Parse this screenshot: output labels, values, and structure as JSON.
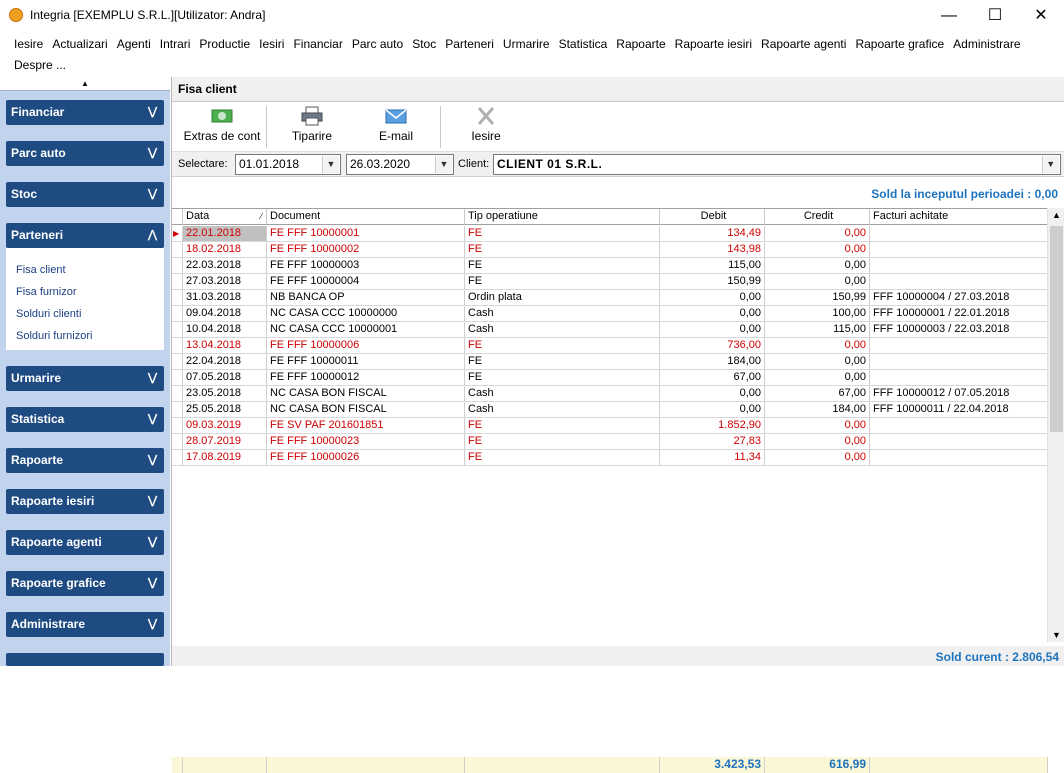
{
  "window": {
    "title": "Integria [EXEMPLU S.R.L.][Utilizator: Andra]"
  },
  "menu": {
    "items": [
      "Iesire",
      "Actualizari",
      "Agenti",
      "Intrari",
      "Productie",
      "Iesiri",
      "Financiar",
      "Parc auto",
      "Stoc",
      "Parteneri",
      "Urmarire",
      "Statistica",
      "Rapoarte",
      "Rapoarte iesiri",
      "Rapoarte agenti",
      "Rapoarte grafice",
      "Administrare",
      "Despre ..."
    ]
  },
  "sidebar": {
    "groups": [
      "Financiar",
      "Parc auto",
      "Stoc",
      "Parteneri",
      "Urmarire",
      "Statistica",
      "Rapoarte",
      "Rapoarte iesiri",
      "Rapoarte agenti",
      "Rapoarte grafice",
      "Administrare"
    ],
    "sub_items": [
      "Fisa client",
      "Fisa furnizor",
      "Solduri clienti",
      "Solduri furnizori"
    ]
  },
  "panel": {
    "title": "Fisa client"
  },
  "toolbar": {
    "extras": "Extras de cont",
    "print": "Tiparire",
    "email": "E-mail",
    "exit": "Iesire"
  },
  "filter": {
    "selectare_label": "Selectare:",
    "date_from": "01.01.2018",
    "date_to": "26.03.2020",
    "client_label": "Client:",
    "client": "CLIENT 01 S.R.L."
  },
  "sold_start": "Sold la inceputul perioadei : 0,00",
  "grid": {
    "columns": [
      "Data",
      "Document",
      "Tip operatiune",
      "Debit",
      "Credit",
      "Facturi achitate"
    ],
    "rows": [
      {
        "date": "22.01.2018",
        "doc": "FE FFF 10000001",
        "tip": "FE",
        "debit": "134,49",
        "credit": "0,00",
        "facturi": "",
        "red": true,
        "sel": true
      },
      {
        "date": "18.02.2018",
        "doc": "FE FFF 10000002",
        "tip": "FE",
        "debit": "143,98",
        "credit": "0,00",
        "facturi": "",
        "red": true
      },
      {
        "date": "22.03.2018",
        "doc": "FE FFF 10000003",
        "tip": "FE",
        "debit": "115,00",
        "credit": "0,00",
        "facturi": "",
        "red": false
      },
      {
        "date": "27.03.2018",
        "doc": "FE FFF 10000004",
        "tip": "FE",
        "debit": "150,99",
        "credit": "0,00",
        "facturi": "",
        "red": false
      },
      {
        "date": "31.03.2018",
        "doc": "NB BANCA OP",
        "tip": "Ordin plata",
        "debit": "0,00",
        "credit": "150,99",
        "facturi": "FFF 10000004 / 27.03.2018",
        "red": false
      },
      {
        "date": "09.04.2018",
        "doc": "NC CASA CCC 10000000",
        "tip": "Cash",
        "debit": "0,00",
        "credit": "100,00",
        "facturi": "FFF 10000001 / 22.01.2018",
        "red": false
      },
      {
        "date": "10.04.2018",
        "doc": "NC CASA CCC 10000001",
        "tip": "Cash",
        "debit": "0,00",
        "credit": "115,00",
        "facturi": "FFF 10000003 / 22.03.2018",
        "red": false
      },
      {
        "date": "13.04.2018",
        "doc": "FE FFF 10000006",
        "tip": "FE",
        "debit": "736,00",
        "credit": "0,00",
        "facturi": "",
        "red": true
      },
      {
        "date": "22.04.2018",
        "doc": "FE FFF 10000011",
        "tip": "FE",
        "debit": "184,00",
        "credit": "0,00",
        "facturi": "",
        "red": false
      },
      {
        "date": "07.05.2018",
        "doc": "FE FFF 10000012",
        "tip": "FE",
        "debit": "67,00",
        "credit": "0,00",
        "facturi": "",
        "red": false
      },
      {
        "date": "23.05.2018",
        "doc": "NC CASA BON FISCAL",
        "tip": "Cash",
        "debit": "0,00",
        "credit": "67,00",
        "facturi": "FFF 10000012 / 07.05.2018",
        "red": false
      },
      {
        "date": "25.05.2018",
        "doc": "NC CASA BON FISCAL",
        "tip": "Cash",
        "debit": "0,00",
        "credit": "184,00",
        "facturi": "FFF 10000011 / 22.04.2018",
        "red": false
      },
      {
        "date": "09.03.2019",
        "doc": "FE SV PAF 201601851",
        "tip": "FE",
        "debit": "1.852,90",
        "credit": "0,00",
        "facturi": "",
        "red": true
      },
      {
        "date": "28.07.2019",
        "doc": "FE FFF 10000023",
        "tip": "FE",
        "debit": "27,83",
        "credit": "0,00",
        "facturi": "",
        "red": true
      },
      {
        "date": "17.08.2019",
        "doc": "FE FFF 10000026",
        "tip": "FE",
        "debit": "11,34",
        "credit": "0,00",
        "facturi": "",
        "red": true
      }
    ],
    "total_debit": "3.423,53",
    "total_credit": "616,99"
  },
  "sold_current": "Sold curent : 2.806,54",
  "colors": {
    "accent": "#1e4b82",
    "sidebar_bg": "#c2d3ee",
    "red": "#d00000",
    "blue_total": "#1e73be",
    "totals_bg": "#fbf6d5"
  }
}
